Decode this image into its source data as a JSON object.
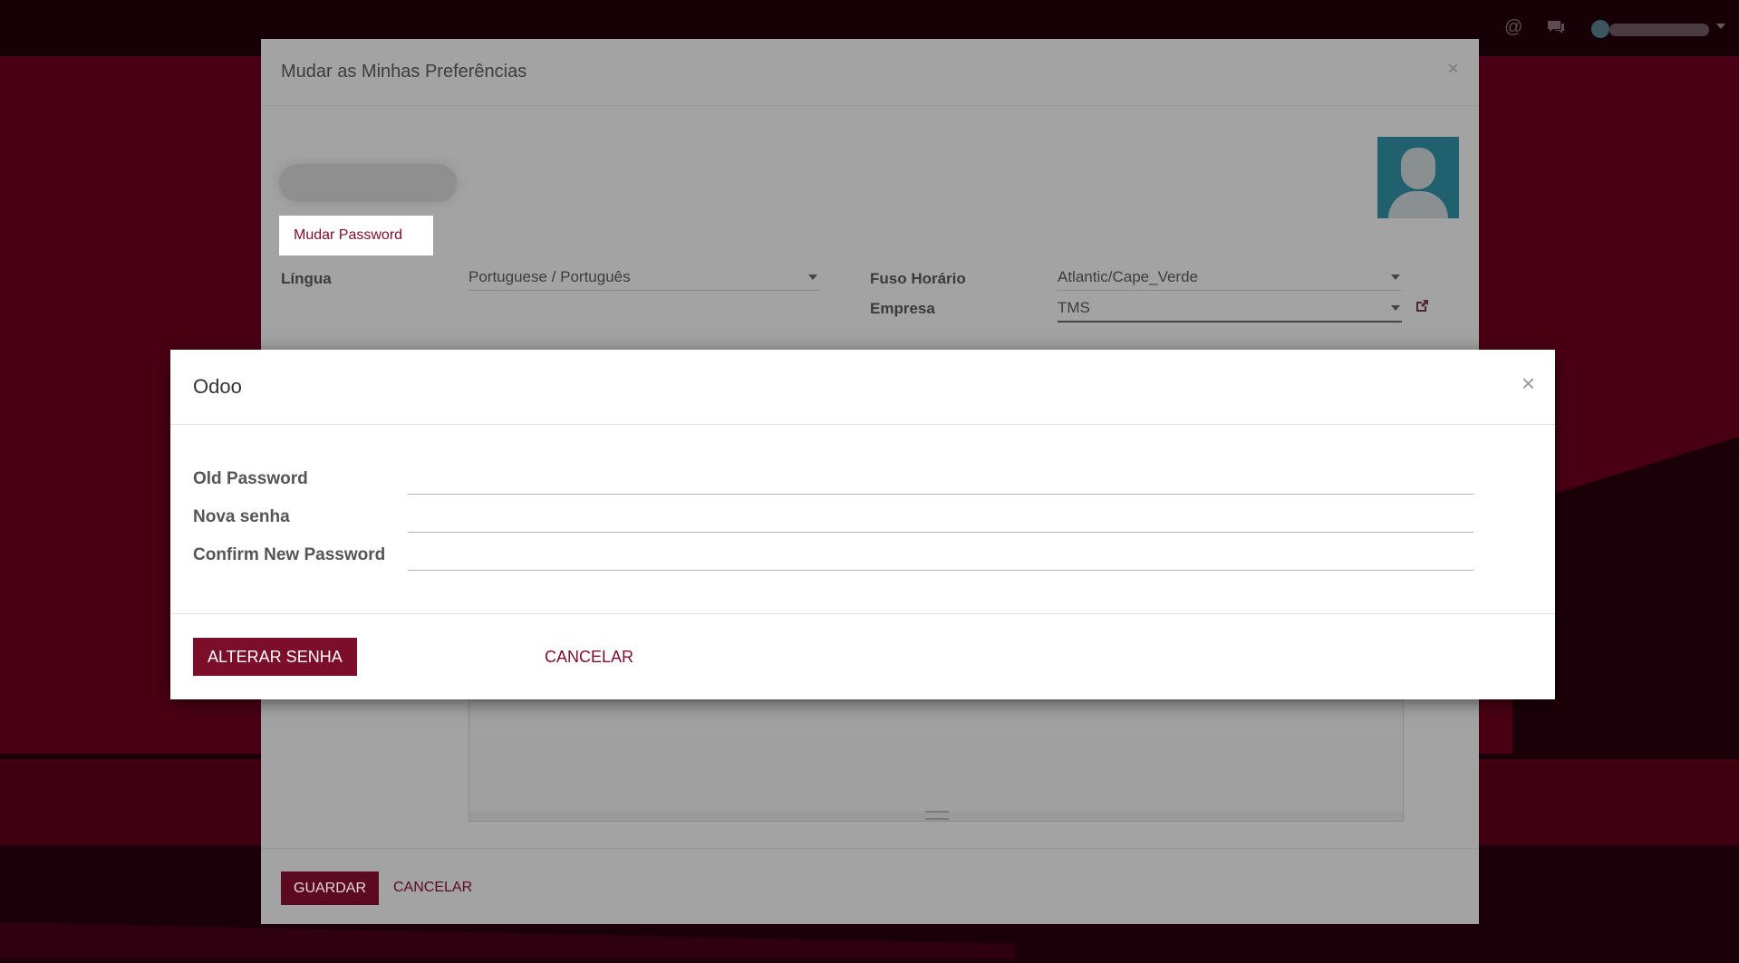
{
  "back_dialog": {
    "title": "Mudar as Minhas Preferências",
    "close_glyph": "×",
    "change_password_label": "Mudar Password",
    "fields": {
      "language_label": "Língua",
      "language_value": "Portuguese / Português",
      "timezone_label": "Fuso Horário",
      "timezone_value": "Atlantic/Cape_Verde",
      "company_label": "Empresa",
      "company_value": "TMS"
    },
    "save_label": "GUARDAR",
    "cancel_label": "CANCELAR"
  },
  "dialog": {
    "title": "Odoo",
    "close_glyph": "×",
    "fields": {
      "old_password_label": "Old Password",
      "new_password_label": "Nova senha",
      "confirm_password_label": "Confirm New Password"
    },
    "submit_label": "ALTERAR SENHA",
    "cancel_label": "CANCELAR"
  },
  "topbar": {
    "icons": [
      "at-icon",
      "chat-icon",
      "user-avatar-icon"
    ]
  },
  "colors": {
    "brand": "#7c0e2b",
    "backdrop": "#4a0014"
  }
}
